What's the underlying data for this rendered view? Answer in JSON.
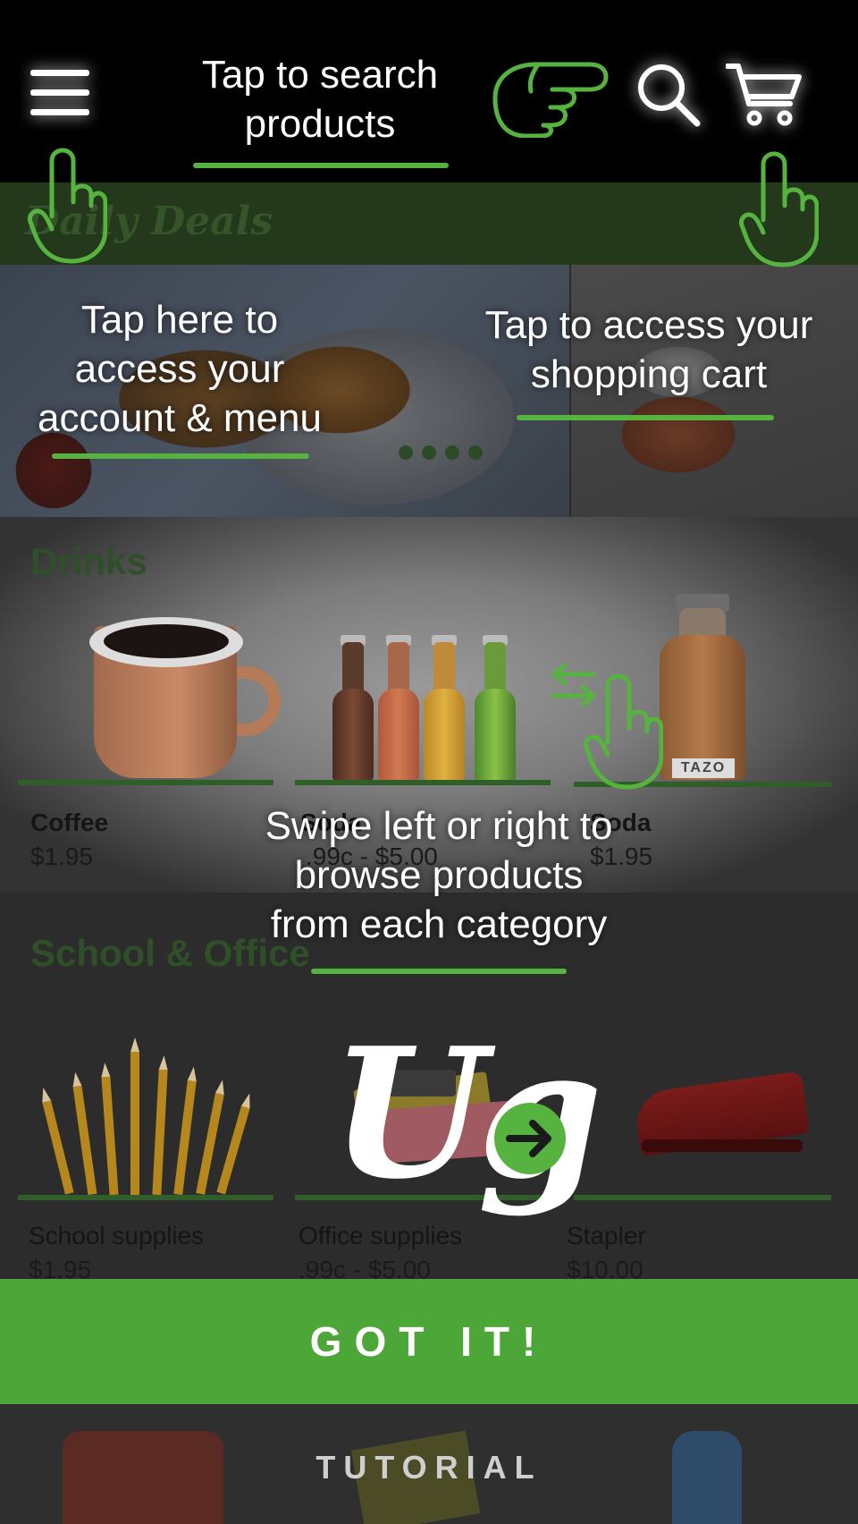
{
  "app": {
    "deals_title": "Daily Deals",
    "carousel_dots": 4,
    "drinks": {
      "title": "Drinks",
      "products": [
        {
          "name": "Coffee",
          "price": "$1.95"
        },
        {
          "name": "Soda",
          "price": ".99c - $5.00"
        },
        {
          "name": "Soda",
          "price": "$1.95"
        }
      ],
      "tea_label": "TAZO"
    },
    "school": {
      "title": "School & Office",
      "products": [
        {
          "name": "School supplies",
          "price": "$1.95"
        },
        {
          "name": "Office supplies",
          "price": ".99c - $5.00"
        },
        {
          "name": "Stapler",
          "price": "$10.00"
        }
      ]
    }
  },
  "tutorial": {
    "search_tip": "Tap to search\nproducts",
    "menu_tip": "Tap here to\naccess your\naccount & menu",
    "cart_tip": "Tap to access your\nshopping cart",
    "swipe_tip": "Swipe left or right to\nbrowse products\nfrom each category",
    "logo_text": "Ug",
    "got_it_button": "GOT IT!",
    "footer_label": "TUTORIAL"
  },
  "colors": {
    "accent": "#56b33f",
    "button_bg": "#4da638",
    "overlay_text": "#ffffff"
  },
  "icons": {
    "menu": "hamburger-menu-icon",
    "search": "search-icon",
    "cart": "cart-icon",
    "hand_tap": "hand-tap-icon",
    "hand_point": "hand-point-right-icon",
    "swipe_arrows": "swipe-arrows-icon",
    "logo_arrow": "arrow-right-circle-icon"
  }
}
